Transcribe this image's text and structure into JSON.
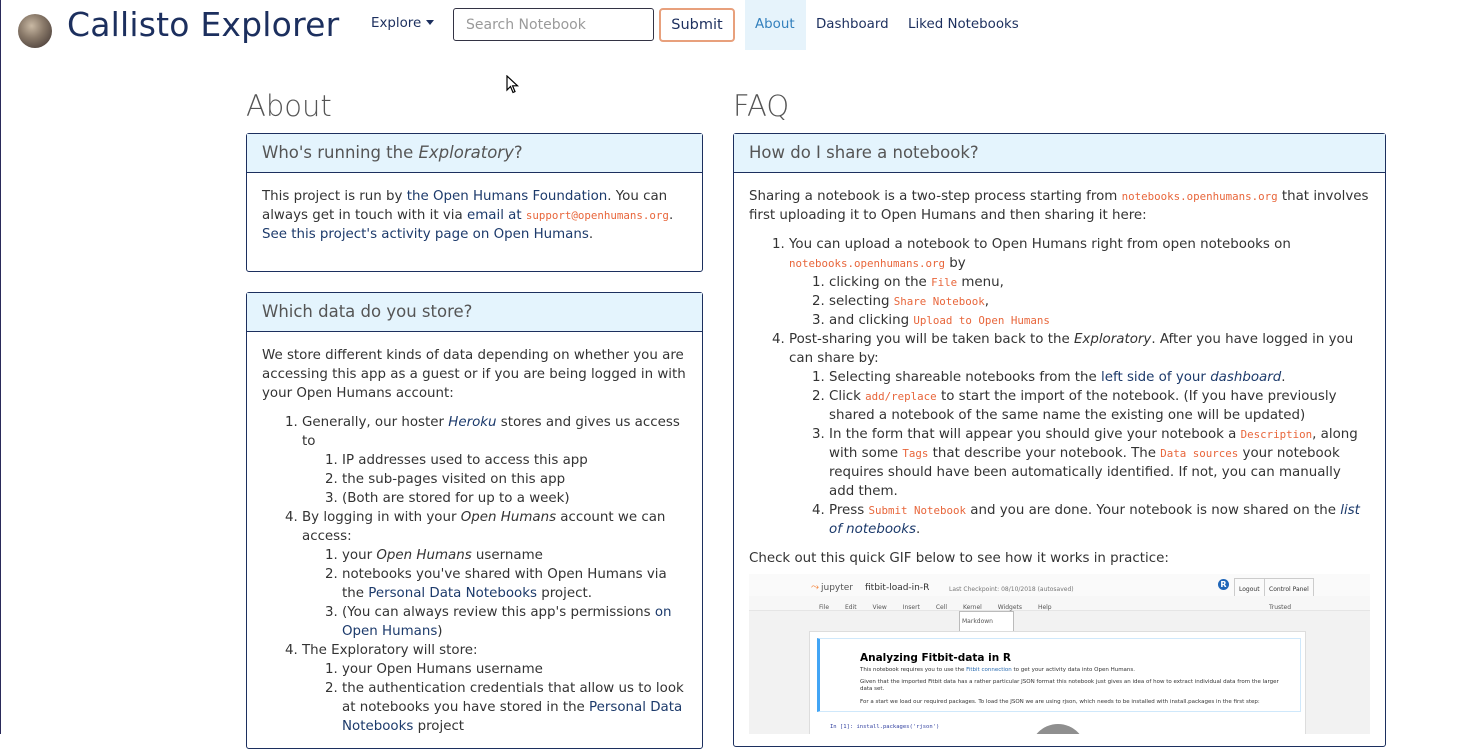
{
  "nav": {
    "brand": "Callisto Explorer",
    "explore_label": "Explore",
    "search_placeholder": "Search Notebook",
    "submit_label": "Submit",
    "links": [
      "About",
      "Dashboard",
      "Liked Notebooks"
    ],
    "active_link": "About"
  },
  "about": {
    "title": "About",
    "card1": {
      "heading_pre": "Who's running the ",
      "heading_em": "Exploratory",
      "heading_post": "?",
      "t1": "This project is run by ",
      "l1": "the Open Humans Foundation",
      "t2": ". You can always get in touch with it via email at ",
      "l2": "email at",
      "code": "support@openhumans.org",
      "t3": ". ",
      "l3": "See this project's activity page on Open Humans",
      "t4": "."
    },
    "card2": {
      "heading": "Which data do you store?",
      "intro": "We store different kinds of data depending on whether you are accessing this app as a guest or if you are being logged in with your Open Humans account:",
      "i1_pre": "Generally, our hoster ",
      "i1_link": "Heroku",
      "i1_post": " stores and gives us access to",
      "i1_sub": [
        "IP addresses used to access this app",
        "the sub-pages visited on this app",
        "(Both are stored for up to a week)"
      ],
      "i2_pre": "By logging in with your ",
      "i2_em": "Open Humans",
      "i2_post": " account we can access:",
      "i2_s1_pre": "your ",
      "i2_s1_em": "Open Humans",
      "i2_s1_post": " username",
      "i2_s2_pre": "notebooks you've shared with Open Humans via the ",
      "i2_s2_link": "Personal Data Notebooks",
      "i2_s2_post": " project.",
      "i2_s3_pre": "(You can always review this app's permissions ",
      "i2_s3_link": "on Open Humans",
      "i2_s3_post": ")",
      "i3": "The Exploratory will store:",
      "i3_s1": "your Open Humans username",
      "i3_s2_pre": "the authentication credentials that allow us to look at notebooks you have stored in the ",
      "i3_s2_link": "Personal Data Notebooks",
      "i3_s2_post": " project"
    }
  },
  "faq": {
    "title": "FAQ",
    "card": {
      "heading": "How do I share a notebook?",
      "intro_pre": "Sharing a notebook is a two-step process starting from ",
      "intro_code": "notebooks.openhumans.org",
      "intro_post": " that involves first uploading it to Open Humans and then sharing it here:",
      "s1_pre": "You can upload a notebook to Open Humans right from open notebooks on ",
      "s1_code": "notebooks.openhumans.org",
      "s1_post": " by",
      "s1a_pre": "clicking on the ",
      "s1a_code": "File",
      "s1a_post": " menu,",
      "s1b_pre": "selecting ",
      "s1b_code": "Share Notebook",
      "s1b_post": ",",
      "s1c_pre": "and clicking ",
      "s1c_code": "Upload to Open Humans",
      "s2_pre": "Post-sharing you will be taken back to the ",
      "s2_em": "Exploratory",
      "s2_post": ". After you have logged in you can share by:",
      "s2a_pre": "Selecting shareable notebooks from the ",
      "s2a_link": "left side of your ",
      "s2a_link_em": "dashboard",
      "s2a_post": ".",
      "s2b_pre": "Click ",
      "s2b_code": "add/replace",
      "s2b_post": " to start the import of the notebook. (If you have previously shared a notebook of the same name the existing one will be updated)",
      "s2c_pre": "In the form that will appear you should give your notebook a ",
      "s2c_code1": "Description",
      "s2c_mid1": ", along with some ",
      "s2c_code2": "Tags",
      "s2c_mid2": " that describe your notebook. The ",
      "s2c_code3": "Data sources",
      "s2c_post": " your notebook requires should have been automatically identified. If not, you can manually add them.",
      "s2d_pre": "Press ",
      "s2d_code": "Submit Notebook",
      "s2d_mid": " and you are done. Your notebook is now shared on the ",
      "s2d_link": "list of notebooks",
      "s2d_post": ".",
      "gif_intro": "Check out this quick GIF below to see how it works in practice:",
      "gif": {
        "app": "jupyter",
        "notebook_name": "fitbit-load-in-R",
        "checkpoint": "Last Checkpoint: 08/10/2018 (autosaved)",
        "logout": "Logout",
        "control_panel": "Control Panel",
        "menu": [
          "File",
          "Edit",
          "View",
          "Insert",
          "Cell",
          "Kernel",
          "Widgets",
          "Help"
        ],
        "trusted": "Trusted",
        "cell_type": "Markdown",
        "heading": "Analyzing Fitbit-data in R",
        "line1_pre": "This notebook requires you to use the ",
        "line1_link": "Fitbit connection",
        "line1_post": " to get your activity data into Open Humans.",
        "line2": "Given that the imported Fitbit data has a rather particular JSON format this notebook just gives an idea of how to extract individual data from the larger data set.",
        "line3": "For a start we load our required packages. To load the JSON we are using rjson, which needs to be installed with install.packages in the first step:",
        "code_line": "In [1]: install.packages('rjson')"
      }
    }
  }
}
